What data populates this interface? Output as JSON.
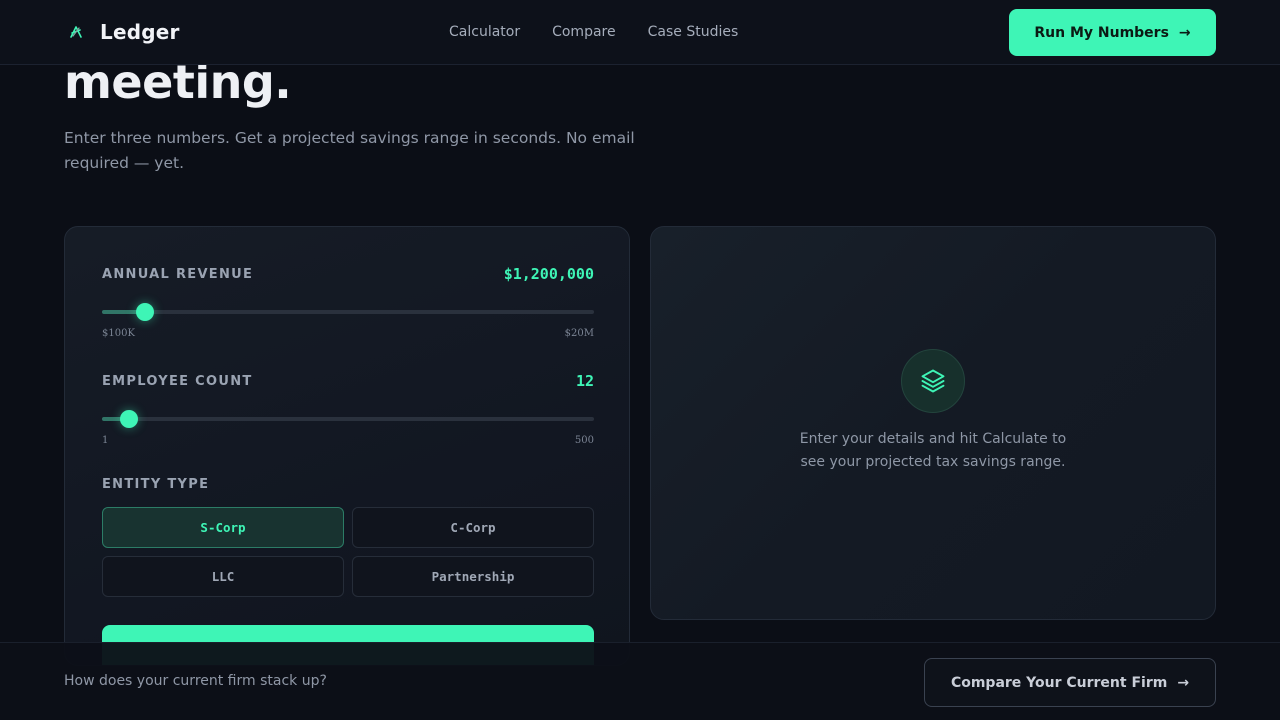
{
  "header": {
    "brand": "Ledger",
    "brand_icon": "ledger-logo-icon",
    "nav": [
      "Calculator",
      "Compare",
      "Case Studies"
    ],
    "cta_label": "Run My Numbers",
    "cta_icon": "arrow-right-icon"
  },
  "hero": {
    "title_fragment": "meeting.",
    "subtitle": "Enter three numbers. Get a projected savings range in seconds. No email required — yet."
  },
  "calculator": {
    "revenue": {
      "label": "ANNUAL REVENUE",
      "value_display": "$1,200,000",
      "min_label": "$100K",
      "max_label": "$20M",
      "min": 100000,
      "max": 20000000,
      "value": 1200000
    },
    "employees": {
      "label": "EMPLOYEE COUNT",
      "value_display": "12",
      "min_label": "1",
      "max_label": "500",
      "min": 1,
      "max": 500,
      "value": 12
    },
    "entity": {
      "label": "ENTITY TYPE",
      "options": [
        "S-Corp",
        "C-Corp",
        "LLC",
        "Partnership"
      ],
      "selected": "S-Corp"
    }
  },
  "result": {
    "icon": "layers-icon",
    "placeholder": "Enter your details and hit Calculate to see your projected tax savings range."
  },
  "bottom_bar": {
    "prompt": "How does your current firm stack up?",
    "button_label": "Compare Your Current Firm",
    "button_icon": "arrow-right-icon"
  },
  "colors": {
    "accent": "#3ef5b6",
    "background": "#0b0e16",
    "card": "#141a24"
  }
}
